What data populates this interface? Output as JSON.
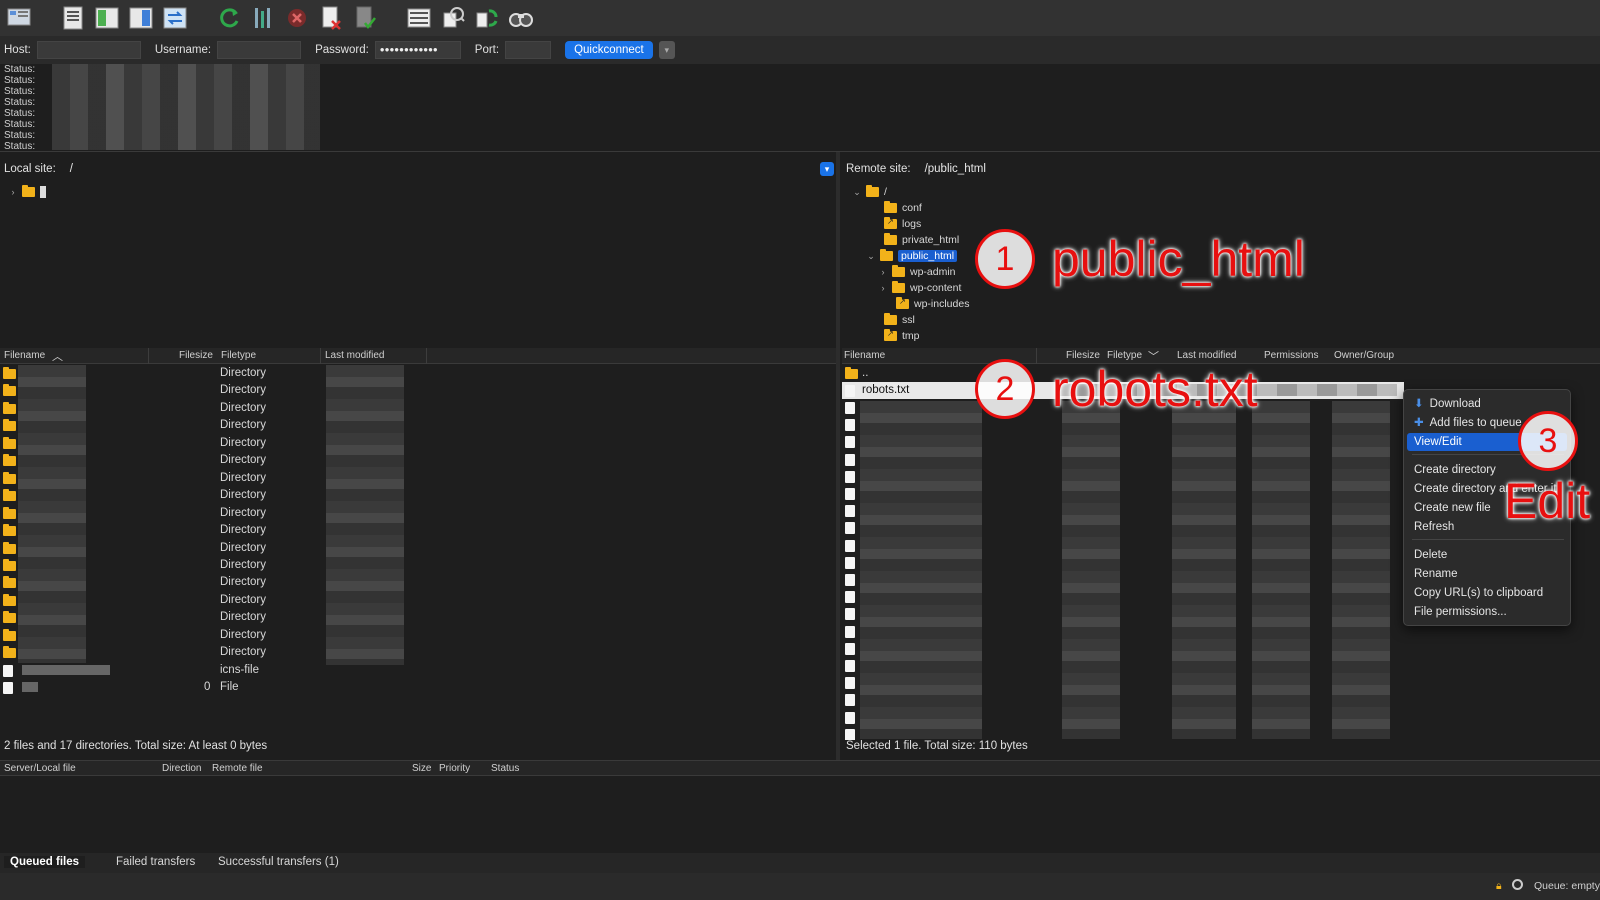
{
  "toolbar": {
    "icons": [
      "site-manager-icon",
      "toggle-log-icon",
      "toggle-local-tree-icon",
      "toggle-remote-tree-icon",
      "transfer-queue-icon",
      "refresh-icon",
      "process-queue-icon",
      "cancel-icon",
      "disconnect-icon",
      "reconnect-icon",
      "directory-listing-filters-icon",
      "compare-icon",
      "sync-browse-icon",
      "search-icon"
    ]
  },
  "quickconnect": {
    "host_label": "Host:",
    "username_label": "Username:",
    "password_label": "Password:",
    "password_value": "●●●●●●●●●●●●",
    "port_label": "Port:",
    "button_label": "Quickconnect"
  },
  "log": {
    "rows": [
      "Status:",
      "Status:",
      "Status:",
      "Status:",
      "Status:",
      "Status:",
      "Status:",
      "Status:"
    ]
  },
  "local": {
    "site_label": "Local site:",
    "path": "/",
    "headers": {
      "filename": "Filename",
      "filesize": "Filesize",
      "filetype": "Filetype",
      "modified": "Last modified"
    },
    "rows": [
      {
        "type": "Directory"
      },
      {
        "type": "Directory"
      },
      {
        "type": "Directory"
      },
      {
        "type": "Directory"
      },
      {
        "type": "Directory"
      },
      {
        "type": "Directory"
      },
      {
        "type": "Directory"
      },
      {
        "type": "Directory"
      },
      {
        "type": "Directory"
      },
      {
        "type": "Directory"
      },
      {
        "type": "Directory"
      },
      {
        "type": "Directory"
      },
      {
        "type": "Directory"
      },
      {
        "type": "Directory"
      },
      {
        "type": "Directory"
      },
      {
        "type": "Directory"
      },
      {
        "type": "Directory"
      },
      {
        "type": "icns-file"
      },
      {
        "type": "File",
        "size": "0"
      }
    ],
    "status": "2 files and 17 directories. Total size: At least 0 bytes"
  },
  "remote": {
    "site_label": "Remote site:",
    "path": "/public_html",
    "tree": {
      "root": "/",
      "conf": "conf",
      "logs": "logs",
      "private_html": "private_html",
      "public_html": "public_html",
      "wp_admin": "wp-admin",
      "wp_content": "wp-content",
      "wp_includes": "wp-includes",
      "ssl": "ssl",
      "tmp": "tmp"
    },
    "headers": {
      "filename": "Filename",
      "filesize": "Filesize",
      "filetype": "Filetype",
      "modified": "Last modified",
      "permissions": "Permissions",
      "owner": "Owner/Group"
    },
    "parent": "..",
    "selected_file": "robots.txt",
    "status": "Selected 1 file. Total size: 110 bytes"
  },
  "context_menu": {
    "download": "Download",
    "add_to_queue": "Add files to queue",
    "view_edit": "View/Edit",
    "create_dir": "Create directory",
    "create_dir_enter": "Create directory and enter it",
    "create_file": "Create new file",
    "refresh": "Refresh",
    "delete": "Delete",
    "rename": "Rename",
    "copy_url": "Copy URL(s) to clipboard",
    "permissions": "File permissions..."
  },
  "queue": {
    "headers": {
      "server": "Server/Local file",
      "direction": "Direction",
      "remote": "Remote file",
      "size": "Size",
      "priority": "Priority",
      "status": "Status"
    },
    "tabs": {
      "queued": "Queued files",
      "failed": "Failed transfers",
      "successful": "Successful transfers (1)"
    },
    "status": "Queue: empty"
  },
  "annotations": {
    "step1_num": "1",
    "step1_text": "public_html",
    "step2_num": "2",
    "step2_text": "robots.txt",
    "step3_num": "3",
    "step3_text": "Edit"
  },
  "colors": {
    "accent": "#1a73e8",
    "annotation": "#e81010",
    "folder": "#f2b21a"
  }
}
